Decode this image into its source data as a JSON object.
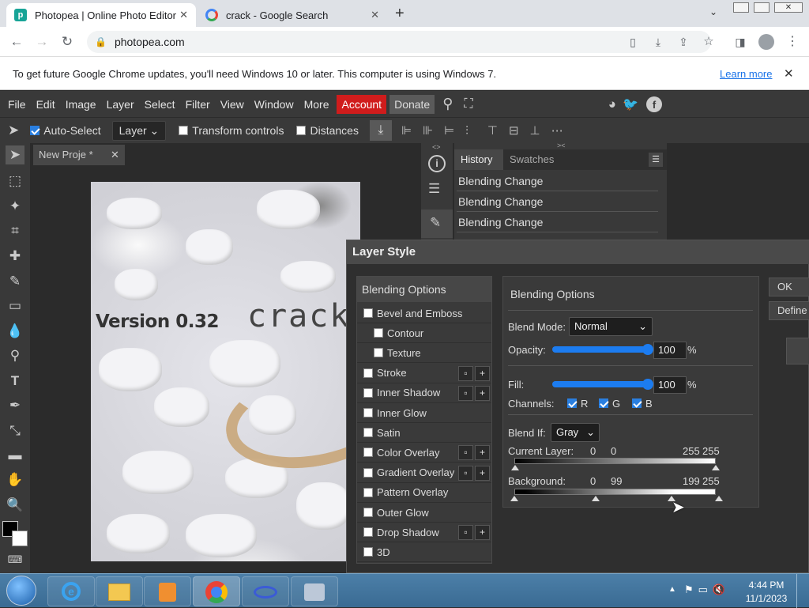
{
  "browser": {
    "tabs": [
      {
        "title": "Photopea | Online Photo Editor",
        "active": true
      },
      {
        "title": "crack - Google Search",
        "active": false
      }
    ],
    "new_tab": "+",
    "url": "photopea.com",
    "infobar": {
      "message": "To get future Google Chrome updates, you'll need Windows 10 or later. This computer is using Windows 7.",
      "link": "Learn more",
      "close": "✕"
    }
  },
  "photopea": {
    "menu": [
      "File",
      "Edit",
      "Image",
      "Layer",
      "Select",
      "Filter",
      "View",
      "Window",
      "More"
    ],
    "account": "Account",
    "donate": "Donate",
    "options": {
      "auto_select": "Auto-Select",
      "layer": "Layer",
      "transform": "Transform controls",
      "distances": "Distances"
    },
    "doc_tab": "New Proje  *",
    "canvas_text": {
      "version": "Version 0.32",
      "crack": "crack"
    },
    "panel_tabs": [
      "History",
      "Swatches"
    ],
    "history": [
      "Blending Change",
      "Blending Change",
      "Blending Change"
    ]
  },
  "dialog": {
    "title": "Layer Style",
    "list_header": "Blending Options",
    "items": [
      {
        "label": "Bevel and Emboss",
        "indent": false,
        "buttons": false
      },
      {
        "label": "Contour",
        "indent": true,
        "buttons": false
      },
      {
        "label": "Texture",
        "indent": true,
        "buttons": false
      },
      {
        "label": "Stroke",
        "indent": false,
        "buttons": true
      },
      {
        "label": "Inner Shadow",
        "indent": false,
        "buttons": true
      },
      {
        "label": "Inner Glow",
        "indent": false,
        "buttons": false
      },
      {
        "label": "Satin",
        "indent": false,
        "buttons": false
      },
      {
        "label": "Color Overlay",
        "indent": false,
        "buttons": true
      },
      {
        "label": "Gradient Overlay",
        "indent": false,
        "buttons": true
      },
      {
        "label": "Pattern Overlay",
        "indent": false,
        "buttons": false
      },
      {
        "label": "Outer Glow",
        "indent": false,
        "buttons": false
      },
      {
        "label": "Drop Shadow",
        "indent": false,
        "buttons": true
      },
      {
        "label": "3D",
        "indent": false,
        "buttons": false
      }
    ],
    "blending": {
      "header": "Blending Options",
      "blend_mode_label": "Blend Mode:",
      "blend_mode": "Normal",
      "opacity_label": "Opacity:",
      "opacity": "100",
      "pct": "%",
      "fill_label": "Fill:",
      "fill": "100",
      "channels_label": "Channels:",
      "channels": [
        "R",
        "G",
        "B"
      ],
      "blend_if_label": "Blend If:",
      "blend_if": "Gray",
      "current_label": "Current Layer:",
      "current_vals": [
        "0",
        "0",
        "255",
        "255"
      ],
      "background_label": "Background:",
      "background_vals": [
        "0",
        "99",
        "199",
        "255"
      ]
    },
    "buttons": {
      "ok": "OK",
      "define": "Define"
    }
  },
  "taskbar": {
    "time": "4:44 PM",
    "date": "11/1/2023"
  }
}
